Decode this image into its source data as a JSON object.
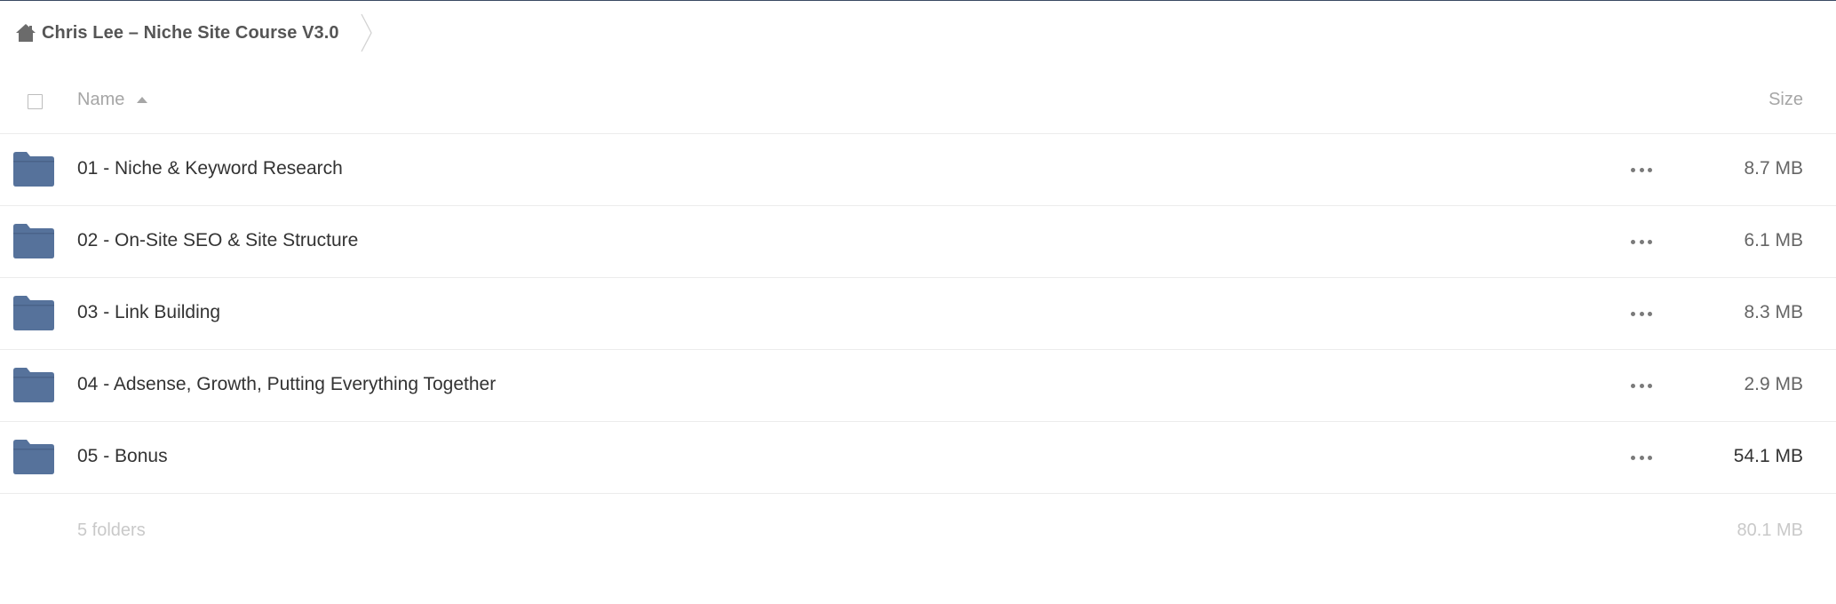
{
  "breadcrumb": {
    "home_icon": "home-icon",
    "title": "Chris Lee – Niche Site Course V3.0"
  },
  "header": {
    "name_label": "Name",
    "size_label": "Size",
    "sort_icon": "sort-ascending-icon"
  },
  "colors": {
    "folder": "#56729b",
    "top_border": "#3a4a63",
    "muted_text": "#a6a6a6"
  },
  "items": [
    {
      "name": "01 - Niche & Keyword Research",
      "size": "8.7 MB",
      "icon": "folder-icon"
    },
    {
      "name": "02 - On-Site SEO & Site Structure",
      "size": "6.1 MB",
      "icon": "folder-icon"
    },
    {
      "name": "03 - Link Building",
      "size": "8.3 MB",
      "icon": "folder-icon"
    },
    {
      "name": "04 - Adsense, Growth, Putting Everything Together",
      "size": "2.9 MB",
      "icon": "folder-icon"
    },
    {
      "name": "05 - Bonus",
      "size": "54.1 MB",
      "icon": "folder-icon"
    }
  ],
  "summary": {
    "count": "5 folders",
    "total_size": "80.1 MB"
  }
}
